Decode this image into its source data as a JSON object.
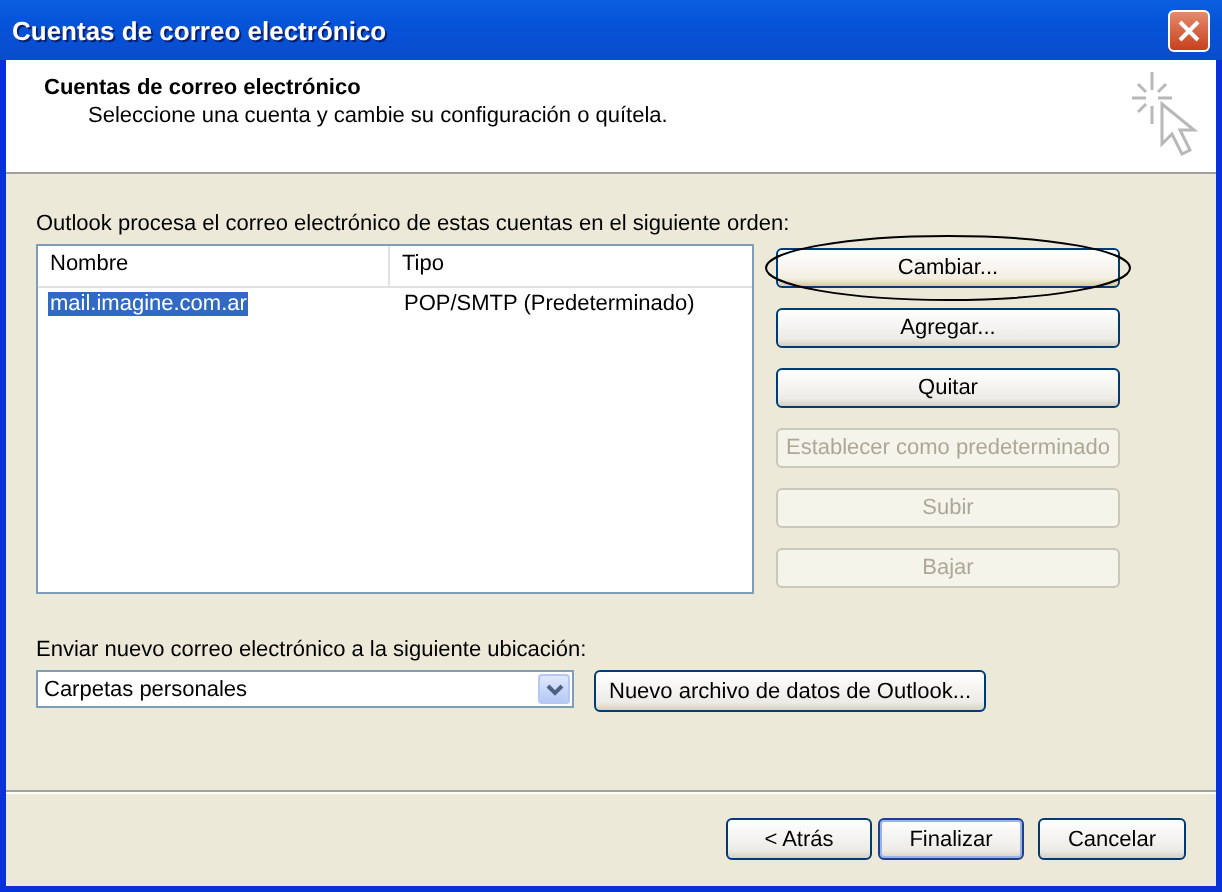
{
  "window": {
    "title": "Cuentas de correo electrónico"
  },
  "header": {
    "title": "Cuentas de correo electrónico",
    "subtitle": "Seleccione una cuenta y cambie su configuración o quítela."
  },
  "accounts": {
    "label": "Outlook procesa el correo electrónico de estas cuentas en el siguiente orden:",
    "columns": [
      "Nombre",
      "Tipo"
    ],
    "rows": [
      {
        "cells": [
          "mail.imagine.com.ar",
          "POP/SMTP (Predeterminado)"
        ],
        "selected": true
      }
    ]
  },
  "side_buttons": [
    {
      "label": "Cambiar...",
      "disabled": false,
      "highlighted": true
    },
    {
      "label": "Agregar...",
      "disabled": false,
      "highlighted": false
    },
    {
      "label": "Quitar",
      "disabled": false,
      "highlighted": false
    },
    {
      "label": "Establecer como predeterminado",
      "disabled": true,
      "highlighted": false
    },
    {
      "label": "Subir",
      "disabled": true,
      "highlighted": false
    },
    {
      "label": "Bajar",
      "disabled": true,
      "highlighted": false
    }
  ],
  "delivery": {
    "label": "Enviar nuevo correo electrónico a la siguiente ubicación:",
    "value": "Carpetas personales",
    "button": "Nuevo archivo de datos de Outlook..."
  },
  "footer_buttons": [
    {
      "label": "< Atrás",
      "default": false
    },
    {
      "label": "Finalizar",
      "default": true
    },
    {
      "label": "Cancelar",
      "default": false
    }
  ]
}
